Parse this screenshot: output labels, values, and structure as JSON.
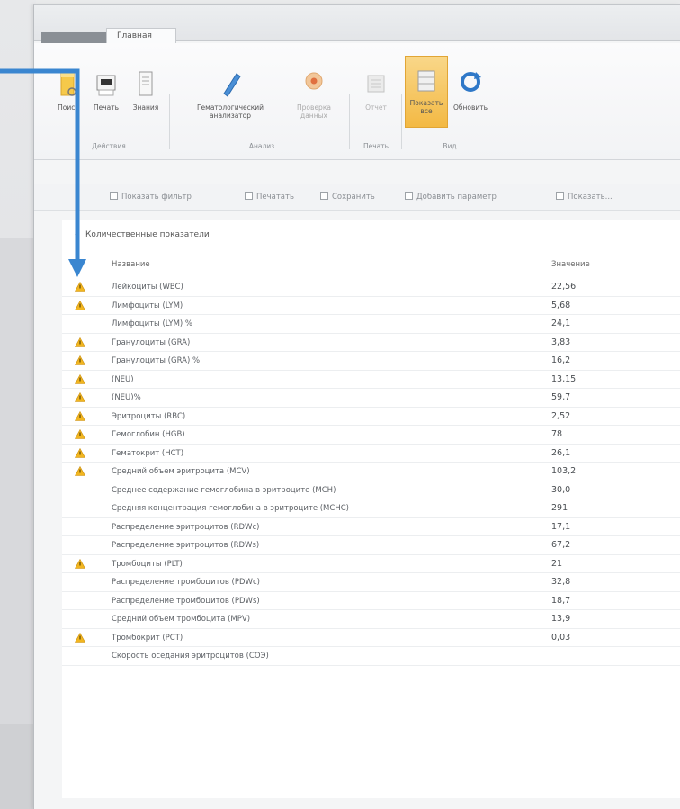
{
  "ribbon": {
    "tab_label": "Главная",
    "buttons": [
      {
        "label": "Поиск"
      },
      {
        "label": "Печать"
      },
      {
        "label": "Знания"
      },
      {
        "label": "Гематологический анализатор"
      },
      {
        "label": "Проверка данных"
      },
      {
        "label": "Отчет"
      },
      {
        "label": "Показать все"
      },
      {
        "label": "Обновить"
      }
    ],
    "groups": [
      {
        "label": "Действия"
      },
      {
        "label": "Анализ"
      },
      {
        "label": "Печать"
      },
      {
        "label": "Вид"
      }
    ]
  },
  "toolbar": {
    "items": [
      {
        "label": "Показать фильтр"
      },
      {
        "label": "Печатать"
      },
      {
        "label": "Сохранить"
      },
      {
        "label": "Добавить параметр"
      },
      {
        "label": "Показать..."
      }
    ]
  },
  "grid": {
    "section_title": "Количественные показатели",
    "columns": {
      "name": "Название",
      "value": "Значение"
    },
    "rows": [
      {
        "name": "Лейкоциты (WBC)",
        "value": "22,56",
        "warning": true
      },
      {
        "name": "Лимфоциты (LYM)",
        "value": "5,68",
        "warning": true
      },
      {
        "name": "Лимфоциты (LYM) %",
        "value": "24,1",
        "warning": false
      },
      {
        "name": "Гранулоциты (GRA)",
        "value": "3,83",
        "warning": true
      },
      {
        "name": "Гранулоциты (GRA) %",
        "value": "16,2",
        "warning": true
      },
      {
        "name": "(NEU)",
        "value": "13,15",
        "warning": true
      },
      {
        "name": "(NEU)%",
        "value": "59,7",
        "warning": true
      },
      {
        "name": "Эритроциты (RBC)",
        "value": "2,52",
        "warning": true
      },
      {
        "name": "Гемоглобин (HGB)",
        "value": "78",
        "warning": true
      },
      {
        "name": "Гематокрит (HCT)",
        "value": "26,1",
        "warning": true
      },
      {
        "name": "Средний объем эритроцита (MCV)",
        "value": "103,2",
        "warning": true
      },
      {
        "name": "Среднее содержание гемоглобина в эритроците (MCH)",
        "value": "30,0",
        "warning": false
      },
      {
        "name": "Средняя концентрация гемоглобина в эритроците (MCHC)",
        "value": "291",
        "warning": false
      },
      {
        "name": "Распределение эритроцитов (RDWc)",
        "value": "17,1",
        "warning": false
      },
      {
        "name": "Распределение эритроцитов (RDWs)",
        "value": "67,2",
        "warning": false
      },
      {
        "name": "Тромбоциты (PLT)",
        "value": "21",
        "warning": true
      },
      {
        "name": "Распределение тромбоцитов (PDWc)",
        "value": "32,8",
        "warning": false
      },
      {
        "name": "Распределение тромбоцитов (PDWs)",
        "value": "18,7",
        "warning": false
      },
      {
        "name": "Средний объем тромбоцита (MPV)",
        "value": "13,9",
        "warning": false
      },
      {
        "name": "Тромбокрит (PCT)",
        "value": "0,03",
        "warning": true
      },
      {
        "name": "Скорость оседания эритроцитов (СОЭ)",
        "value": "",
        "warning": false
      }
    ]
  },
  "colors": {
    "warning": "#f2b620",
    "selected_button": "#f3b944",
    "annotation_arrow": "#3a86d0"
  }
}
